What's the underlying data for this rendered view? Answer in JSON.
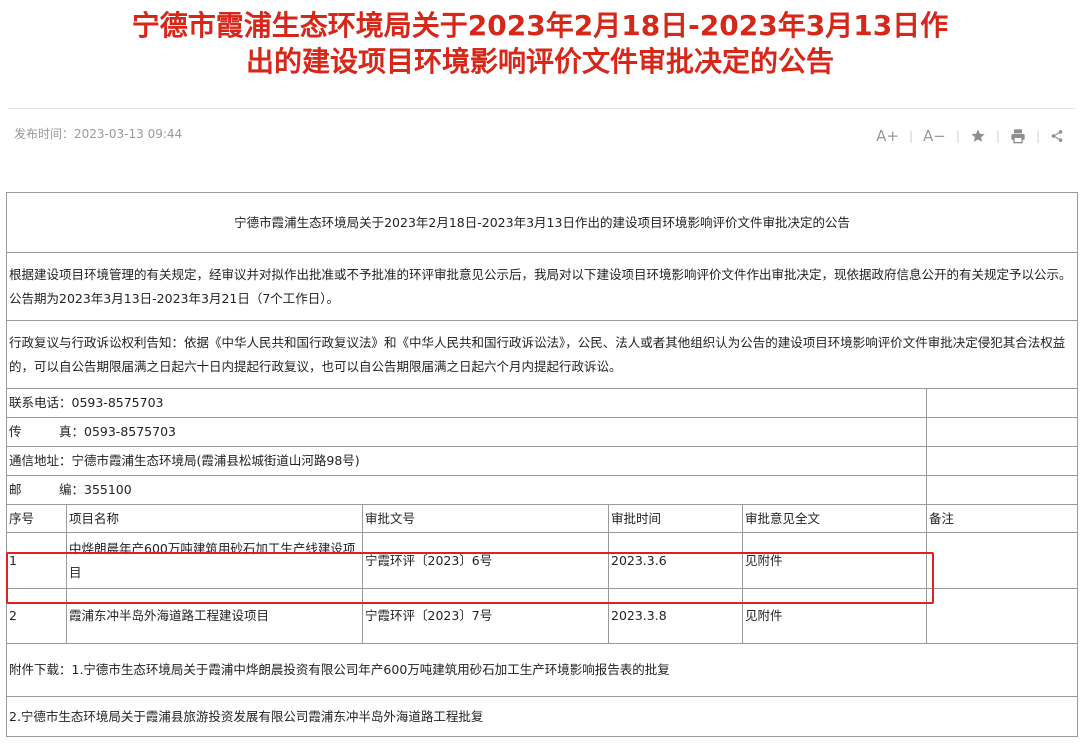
{
  "header": {
    "title_line1": "宁德市霞浦生态环境局关于2023年2月18日-2023年3月13日作",
    "title_line2": "出的建设项目环境影响评价文件审批决定的公告",
    "publish_label": "发布时间：",
    "publish_time": "2023-03-13 09:44"
  },
  "toolbar": {
    "font_increase": "A+",
    "font_decrease": "A−",
    "separator": "|"
  },
  "doc": {
    "table_title": "宁德市霞浦生态环境局关于2023年2月18日-2023年3月13日作出的建设项目环境影响评价文件审批决定的公告",
    "para1": "根据建设项目环境管理的有关规定，经审议并对拟作出批准或不予批准的环评审批意见公示后，我局对以下建设项目环境影响评价文件作出审批决定，现依据政府信息公开的有关规定予以公示。公告期为2023年3月13日-2023年3月21日（7个工作日）。",
    "para2": "行政复议与行政诉讼权利告知：依据《中华人民共和国行政复议法》和《中华人民共和国行政诉讼法》，公民、法人或者其他组织认为公告的建设项目环境影响评价文件审批决定侵犯其合法权益的，可以自公告期限届满之日起六十日内提起行政复议，也可以自公告期限届满之日起六个月内提起行政诉讼。",
    "contact": {
      "phone": "联系电话：0593-8575703",
      "fax": "传　　　真：0593-8575703",
      "address": "通信地址：宁德市霞浦生态环境局(霞浦县松城街道山河路98号)",
      "postcode": "邮　　　编：355100"
    },
    "columns": [
      "序号",
      "项目名称",
      "审批文号",
      "审批时间",
      "审批意见全文",
      "备注"
    ],
    "rows": [
      [
        "1",
        "中烨朗晨年产600万吨建筑用砂石加工生产线建设项目",
        "宁霞环评〔2023〕6号",
        "2023.3.6",
        "见附件",
        ""
      ],
      [
        "2",
        "霞浦东冲半岛外海道路工程建设项目",
        "宁霞环评〔2023〕7号",
        "2023.3.8",
        "见附件",
        ""
      ]
    ],
    "attachment1": "附件下载：1.宁德市生态环境局关于霞浦中烨朗晨投资有限公司年产600万吨建筑用砂石加工生产环境影响报告表的批复",
    "attachment2": "2.宁德市生态环境局关于霞浦县旅游投资发展有限公司霞浦东冲半岛外海道路工程批复"
  },
  "colors": {
    "title_red": "#d62718",
    "highlight": "#e02020"
  }
}
